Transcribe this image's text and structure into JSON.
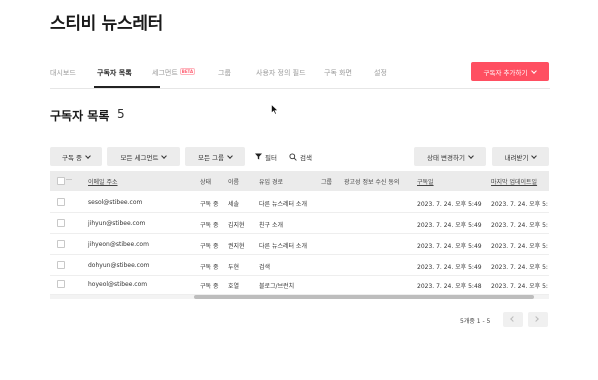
{
  "app": {
    "title": "스티비 뉴스레터"
  },
  "tabs": [
    {
      "label": "대시보드"
    },
    {
      "label": "구독자 목록",
      "active": true
    },
    {
      "label": "세그먼트",
      "badge": "BETA"
    },
    {
      "label": "그룹"
    },
    {
      "label": "사용자 정의 필드"
    },
    {
      "label": "구독 화면"
    },
    {
      "label": "설정"
    }
  ],
  "header": {
    "add_button": "구독자 추가하기"
  },
  "list": {
    "title": "구독자 목록",
    "count": "5"
  },
  "toolbar": {
    "status_filter": "구독 중",
    "segment_filter": "모든 세그먼트",
    "group_filter": "모든 그룹",
    "filter_label": "필터",
    "search_label": "검색",
    "change_status": "상태 변경하기",
    "download": "내려받기"
  },
  "table": {
    "columns": [
      "이메일 주소",
      "상태",
      "이름",
      "유입 경로",
      "그룹",
      "광고성 정보 수신 동의",
      "구독일",
      "마지막 업데이트일"
    ],
    "rows": [
      [
        "sesol@stibee.com",
        "구독 중",
        "세솔",
        "다른 뉴스레터 소개",
        "",
        "",
        "2023. 7. 24. 오후 5:49",
        "2023. 7. 24. 오후 5:"
      ],
      [
        "jihyun@stibee.com",
        "구독 중",
        "김지현",
        "친구 소개",
        "",
        "",
        "2023. 7. 24. 오후 5:49",
        "2023. 7. 24. 오후 5:"
      ],
      [
        "jihyeon@stibee.com",
        "구독 중",
        "권지현",
        "다른 뉴스레터 소개",
        "",
        "",
        "2023. 7. 24. 오후 5:49",
        "2023. 7. 24. 오후 5:"
      ],
      [
        "dohyun@stibee.com",
        "구독 중",
        "두현",
        "검색",
        "",
        "",
        "2023. 7. 24. 오후 5:49",
        "2023. 7. 24. 오후 5:"
      ],
      [
        "hoyeol@stibee.com",
        "구독 중",
        "호열",
        "블로그/브런치",
        "",
        "",
        "2023. 7. 24. 오후 5:48",
        "2023. 7. 24. 오후 5:"
      ]
    ]
  },
  "pagination": {
    "label": "5개중 1 - 5"
  },
  "colors": {
    "accent": "#ff4f61",
    "header_bg": "#ebebeb",
    "button_bg": "#ececec"
  }
}
